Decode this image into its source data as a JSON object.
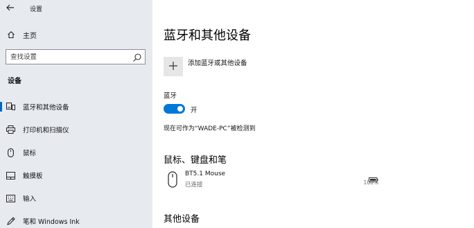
{
  "window": {
    "title": "设置"
  },
  "sidebar": {
    "home_label": "主页",
    "search": {
      "placeholder": "查找设置"
    },
    "section_label": "设备",
    "items": [
      {
        "label": "蓝牙和其他设备",
        "icon": "bluetooth-devices-icon",
        "active": true
      },
      {
        "label": "打印机和扫描仪",
        "icon": "printer-icon",
        "active": false
      },
      {
        "label": "鼠标",
        "icon": "mouse-icon",
        "active": false
      },
      {
        "label": "触摸板",
        "icon": "touchpad-icon",
        "active": false
      },
      {
        "label": "输入",
        "icon": "keyboard-icon",
        "active": false
      },
      {
        "label": "笔和 Windows Ink",
        "icon": "pen-icon",
        "active": false
      }
    ]
  },
  "main": {
    "title": "蓝牙和其他设备",
    "add_device_label": "添加蓝牙或其他设备",
    "bluetooth": {
      "label": "蓝牙",
      "state": "开",
      "on": true
    },
    "discoverable_text": "现在可作为“WADE-PC”被检测到",
    "mouse_section": {
      "heading": "鼠标、键盘和笔",
      "devices": [
        {
          "name": "BT5.1 Mouse",
          "status": "已连接",
          "battery": "100%"
        }
      ]
    },
    "other_section": {
      "heading": "其他设备"
    }
  },
  "colors": {
    "accent": "#0078d7",
    "sidebar_bg": "#e7ebf0",
    "tile_bg": "#e6e6e6"
  }
}
